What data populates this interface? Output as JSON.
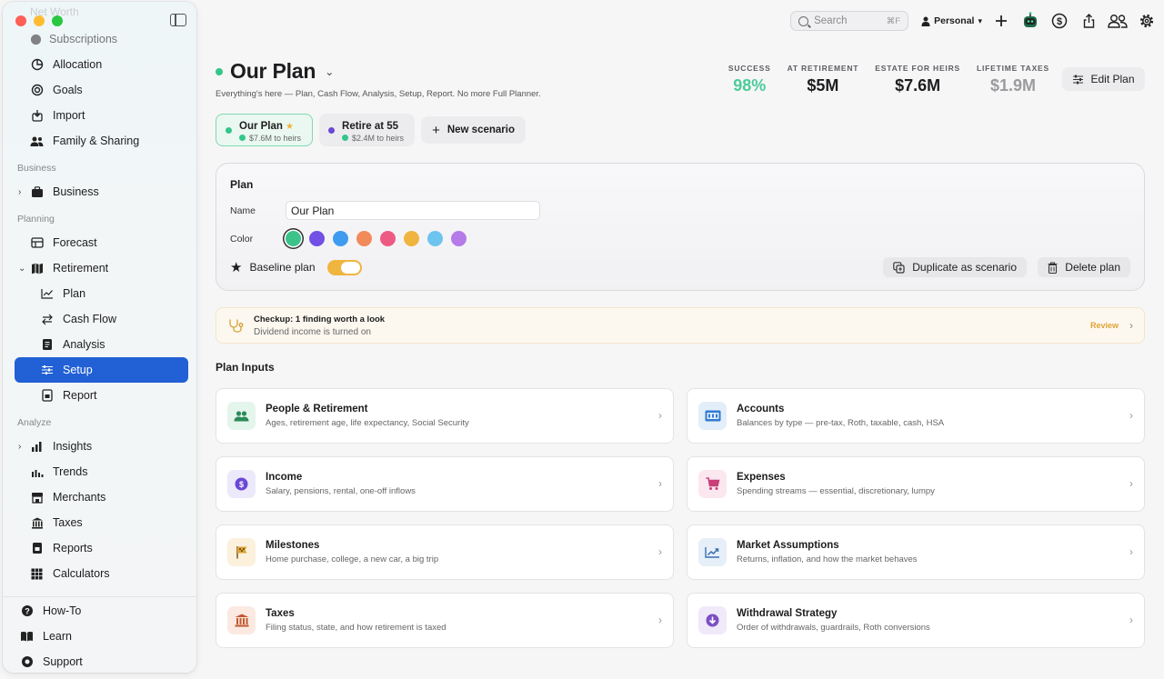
{
  "window": {
    "ghost_item": "Net Worth",
    "faded_item": "Subscriptions"
  },
  "sidebar": {
    "top_items": [
      {
        "label": "Allocation",
        "icon": "pie-icon"
      },
      {
        "label": "Goals",
        "icon": "target-icon"
      },
      {
        "label": "Import",
        "icon": "import-icon"
      },
      {
        "label": "Family & Sharing",
        "icon": "people-icon"
      }
    ],
    "sections": {
      "business": "Business",
      "planning": "Planning",
      "analyze": "Analyze"
    },
    "business_item": "Business",
    "planning_items": {
      "forecast": "Forecast",
      "retirement": "Retirement",
      "plan": "Plan",
      "cash_flow": "Cash Flow",
      "analysis": "Analysis",
      "setup": "Setup",
      "report": "Report"
    },
    "analyze_items": {
      "insights": "Insights",
      "trends": "Trends",
      "merchants": "Merchants",
      "taxes": "Taxes",
      "reports": "Reports",
      "calculators": "Calculators"
    },
    "bottom_items": {
      "howto": "How-To",
      "learn": "Learn",
      "support": "Support"
    }
  },
  "topbar": {
    "search_placeholder": "Search",
    "search_shortcut": "⌘F",
    "profile": "Personal"
  },
  "header": {
    "title": "Our Plan",
    "subtitle": "Everything's here — Plan, Cash Flow, Analysis, Setup, Report. No more Full Planner.",
    "stats": [
      {
        "label": "SUCCESS",
        "value": "98%"
      },
      {
        "label": "AT RETIREMENT",
        "value": "$5M"
      },
      {
        "label": "ESTATE FOR HEIRS",
        "value": "$7.6M"
      },
      {
        "label": "LIFETIME TAXES",
        "value": "$1.9M"
      }
    ],
    "edit_label": "Edit Plan"
  },
  "scenarios": [
    {
      "name": "Our Plan",
      "sub": "$7.6M to heirs",
      "color": "#34c68a"
    },
    {
      "name": "Retire at 55",
      "sub": "$2.4M to heirs",
      "color": "#6b47d6"
    }
  ],
  "new_scenario_label": "New scenario",
  "plan_panel": {
    "title": "Plan",
    "name_label": "Name",
    "name_value": "Our Plan",
    "color_label": "Color",
    "colors": [
      "#3bc38a",
      "#7250e6",
      "#3f9bf0",
      "#f28a5a",
      "#ee5b82",
      "#f0b53f",
      "#6cc4ef",
      "#b57be8"
    ],
    "baseline_label": "Baseline plan",
    "duplicate_label": "Duplicate as scenario",
    "delete_label": "Delete plan"
  },
  "checkup": {
    "title": "Checkup: 1 finding worth a look",
    "detail": "Dividend income is turned on",
    "action": "Review"
  },
  "plan_inputs": {
    "heading": "Plan Inputs",
    "cards": [
      {
        "title": "People & Retirement",
        "sub": "Ages, retirement age, life expectancy, Social Security"
      },
      {
        "title": "Accounts",
        "sub": "Balances by type — pre-tax, Roth, taxable, cash, HSA"
      },
      {
        "title": "Income",
        "sub": "Salary, pensions, rental, one-off inflows"
      },
      {
        "title": "Expenses",
        "sub": "Spending streams — essential, discretionary, lumpy"
      },
      {
        "title": "Milestones",
        "sub": "Home purchase, college, a new car, a big trip"
      },
      {
        "title": "Market Assumptions",
        "sub": "Returns, inflation, and how the market behaves"
      },
      {
        "title": "Taxes",
        "sub": "Filing status, state, and how retirement is taxed"
      },
      {
        "title": "Withdrawal Strategy",
        "sub": "Order of withdrawals, guardrails, Roth conversions"
      }
    ]
  }
}
